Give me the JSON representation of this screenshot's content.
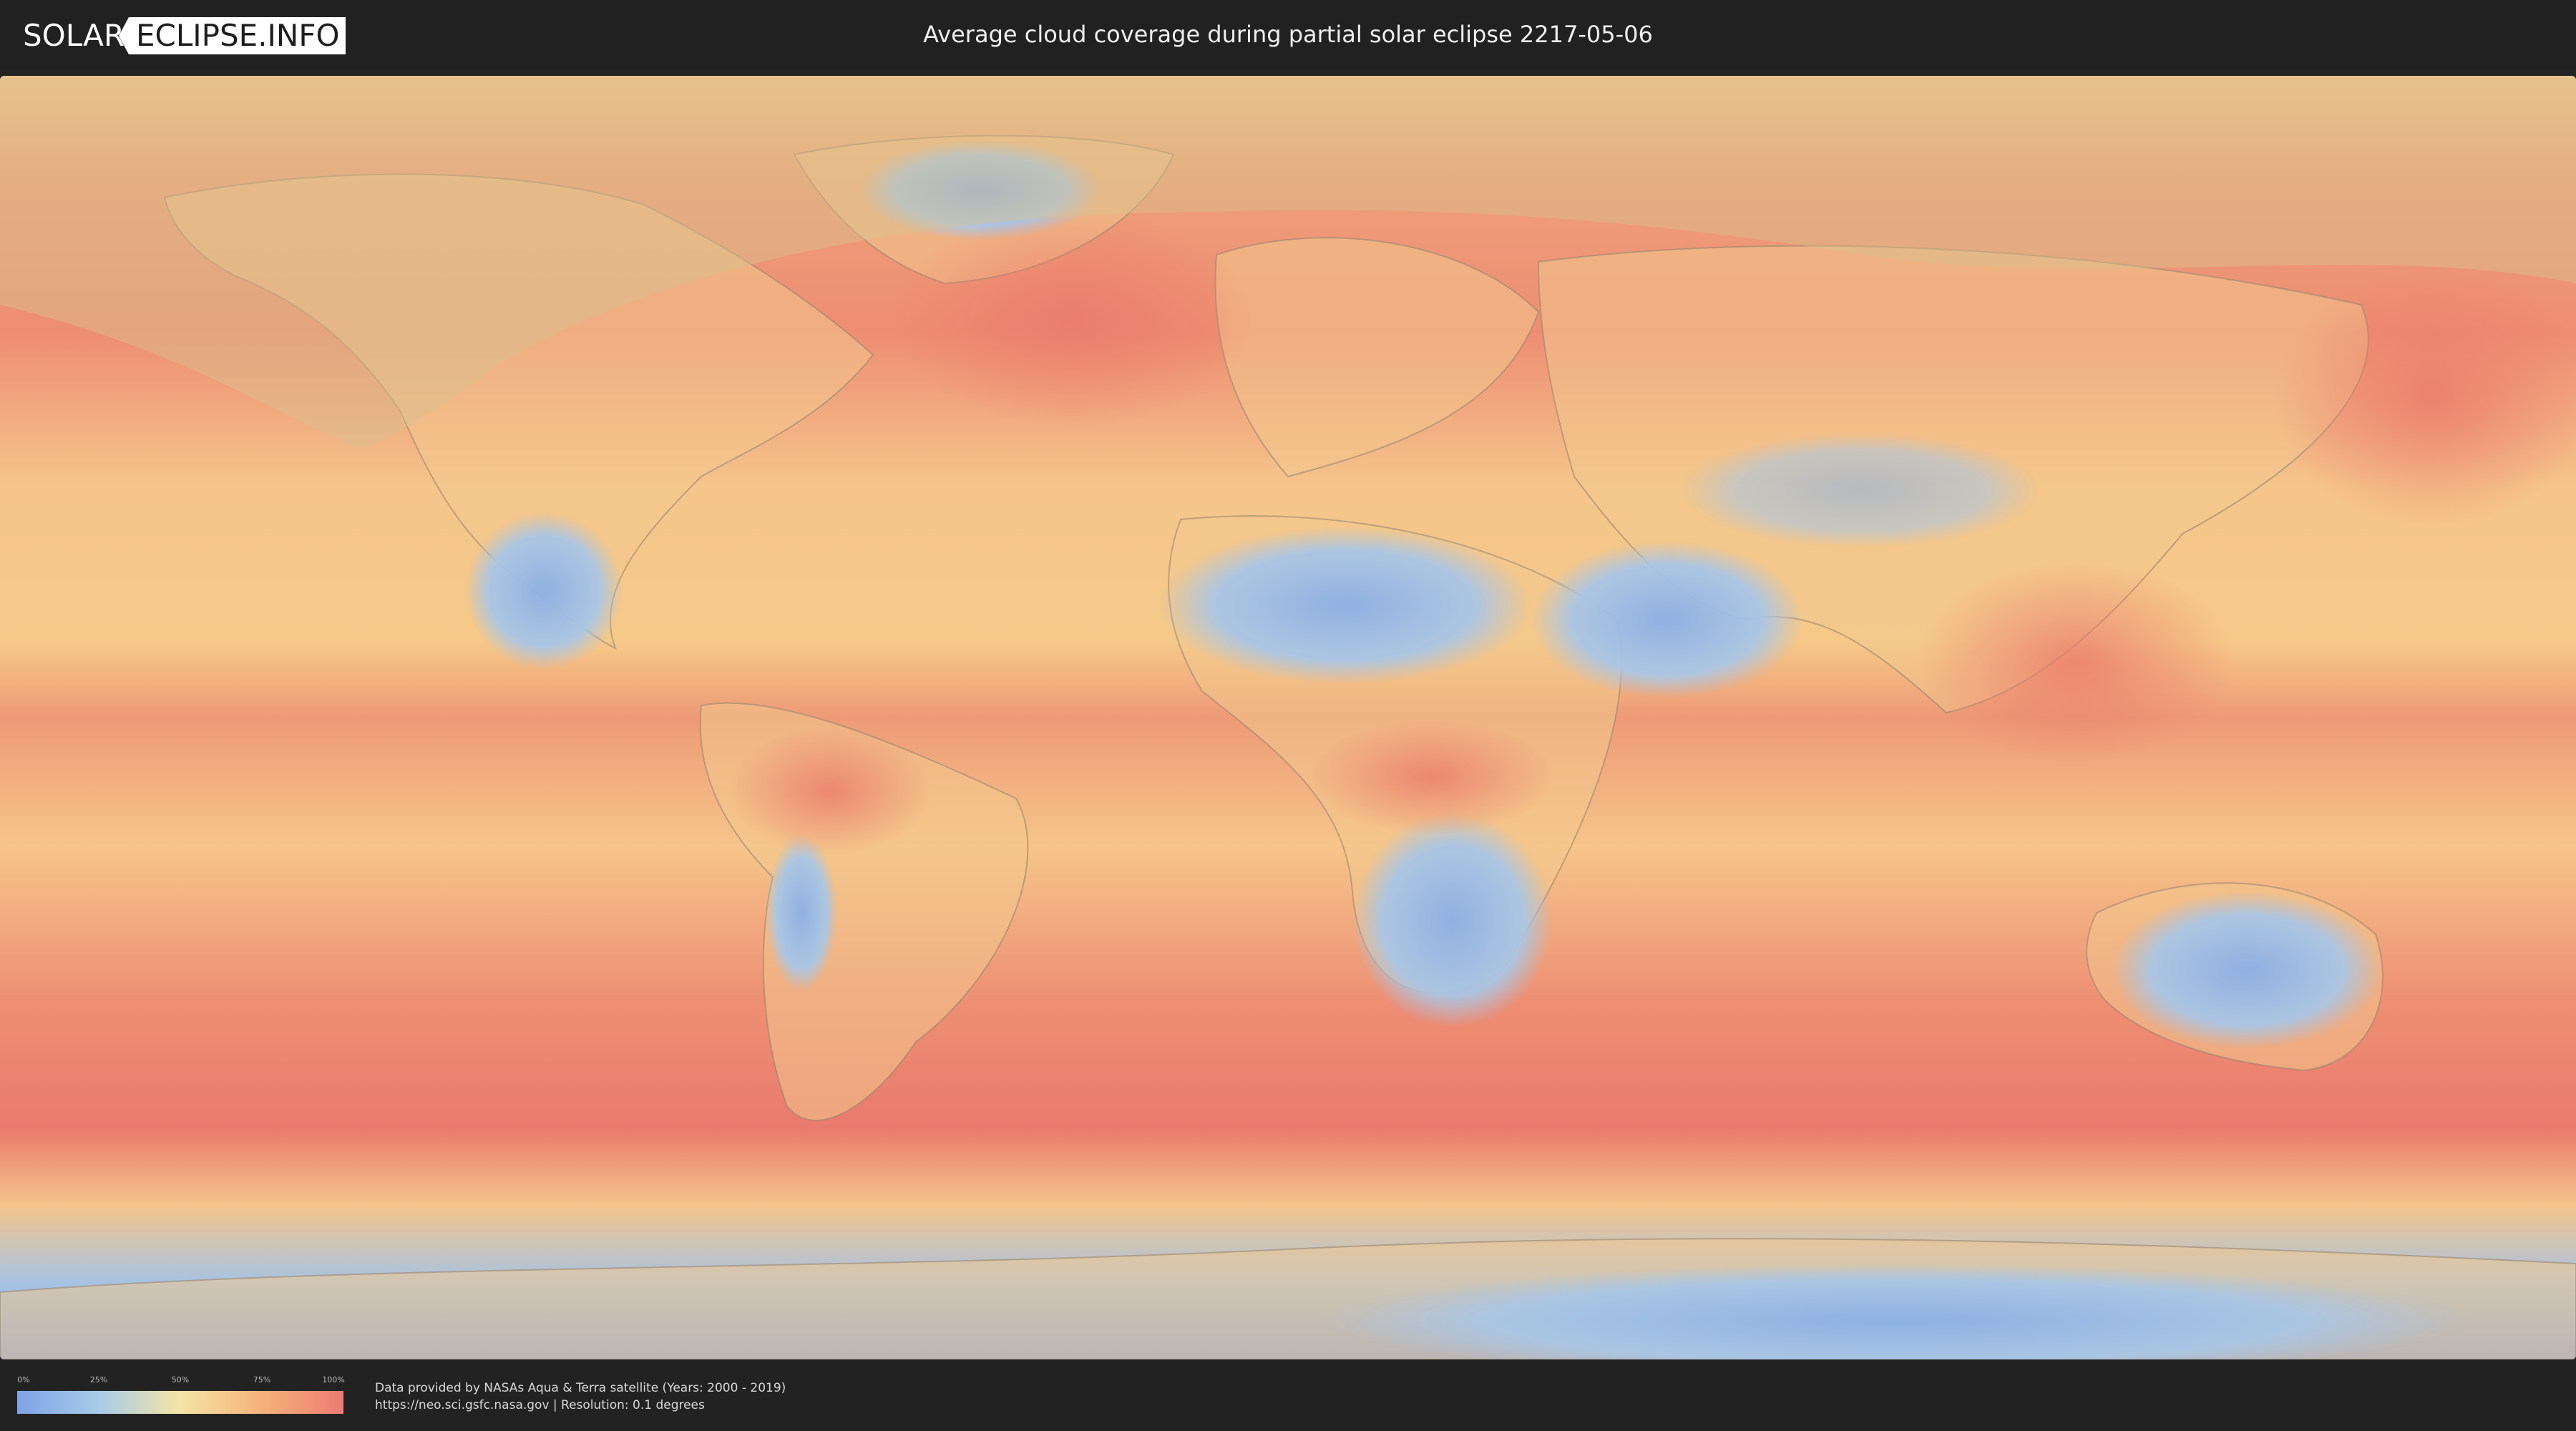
{
  "header": {
    "logo_part1": "SOLAR",
    "logo_part2": "ECLIPSE.INFO",
    "title": "Average cloud coverage during partial solar eclipse 2217-05-06"
  },
  "map": {
    "color_scale": {
      "low": "#7ea2e6",
      "mid_low": "#a8cbe8",
      "mid": "#f3e5a5",
      "mid_high": "#f4b27a",
      "high": "#ee7b72"
    }
  },
  "legend": {
    "ticks": [
      {
        "label": "0%",
        "value": 0
      },
      {
        "label": "25%",
        "value": 25
      },
      {
        "label": "50%",
        "value": 50
      },
      {
        "label": "75%",
        "value": 75
      },
      {
        "label": "100%",
        "value": 100
      }
    ]
  },
  "footer": {
    "credit_line1": "Data provided by NASAs Aqua & Terra satellite (Years: 2000 - 2019)",
    "credit_line2": "https://neo.sci.gsfc.nasa.gov | Resolution: 0.1 degrees"
  }
}
